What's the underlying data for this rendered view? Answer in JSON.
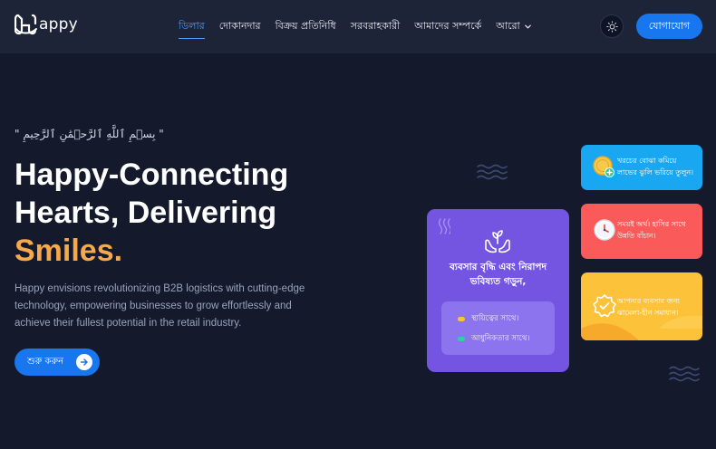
{
  "brand": {
    "name": "appy"
  },
  "nav": {
    "items": [
      {
        "label": "ডিলার",
        "active": true
      },
      {
        "label": "দোকানদার",
        "active": false
      },
      {
        "label": "বিক্রয় প্রতিনিধি",
        "active": false
      },
      {
        "label": "সরবরাহকারী",
        "active": false
      },
      {
        "label": "আমাদের সম্পর্কে",
        "active": false
      }
    ],
    "more_label": "আরো",
    "theme_icon": "sun-icon",
    "contact_label": "যোগাযোগ"
  },
  "hero": {
    "bismillah": "\" بِسۡمِ ٱللَّهِ ٱلرَّحۡمَٰنِ ٱلرَّحِيمِ \"",
    "headline_line1": "Happy-Connecting",
    "headline_line2": "Hearts, Delivering",
    "headline_accent": "Smiles",
    "headline_dot": ".",
    "description": "Happy envisions revolutionizing B2B logistics with cutting-edge technology, empowering businesses to grow effortlessly and achieve their fullest potential in the retail industry.",
    "cta_label": "শুরু করুন",
    "cta_icon": "arrow-right-icon"
  },
  "feature_card": {
    "icon": "plant-in-hands-icon",
    "title": "ব্যবসার বৃদ্ধি এবং নিরাপদ ভবিষ্যত গড়ুন,",
    "points": [
      {
        "label": "স্থায়িত্বের সাথে।",
        "color": "#fcc23a"
      },
      {
        "label": "আধুনিকতার সাথে।",
        "color": "#2fd39a"
      }
    ]
  },
  "side_cards": [
    {
      "text": "খরচের বোঝা কমিয়ে লাভের ঝুলি ভরিয়ে তুলুন।",
      "icon": "coin-add-icon",
      "color": "#1aa7f2"
    },
    {
      "text": "সময়ই অর্থ। হাসির সাথে উন্নতি বাঁচান।",
      "icon": "clock-icon",
      "color": "#fa5a5a"
    },
    {
      "text": "আপনার ব্যবসার জন্য ঝামেলা-হীন সমাধান।",
      "icon": "verified-badge-icon",
      "color": "#fcc23a"
    }
  ]
}
